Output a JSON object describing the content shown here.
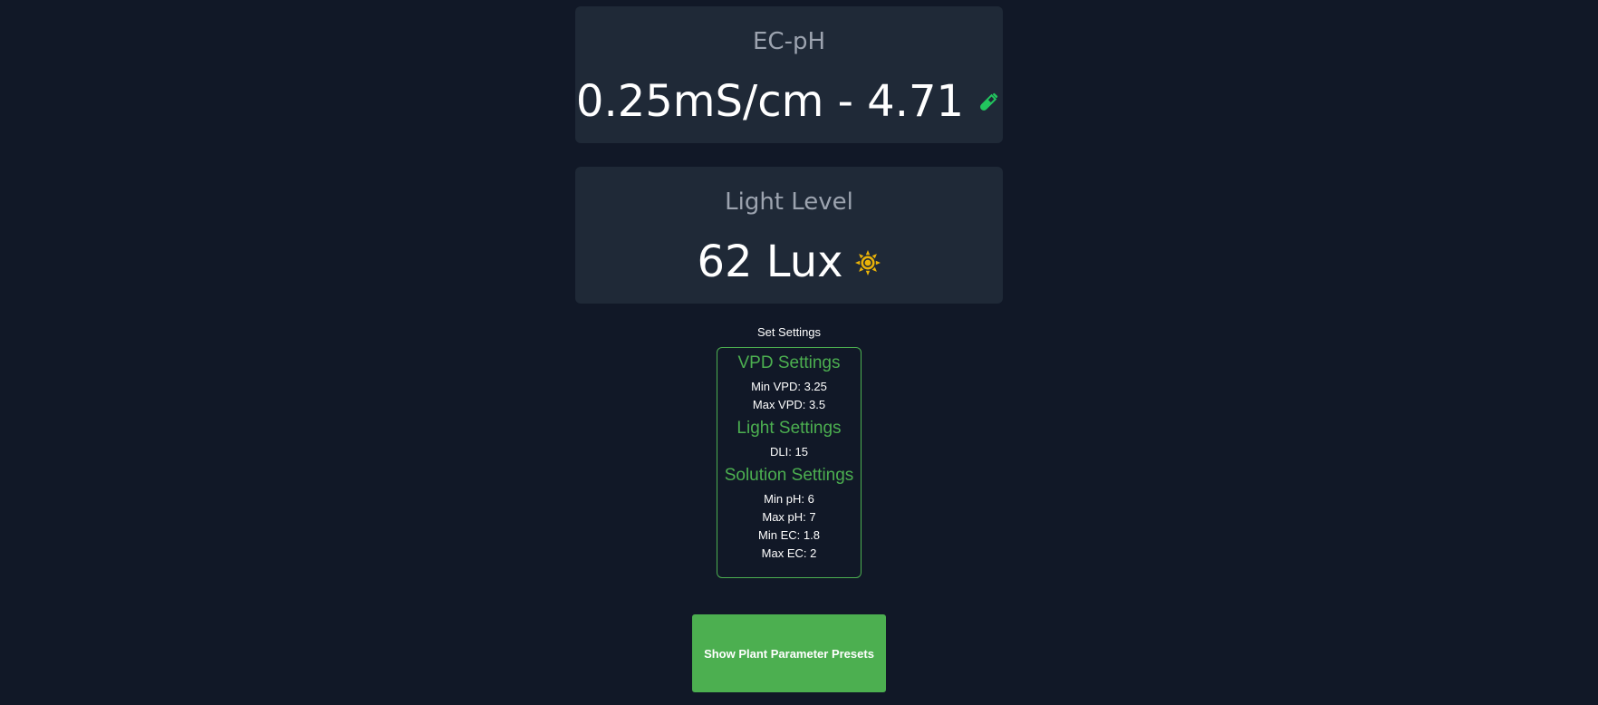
{
  "ecph_card": {
    "title": "EC-pH",
    "value": "0.25mS/cm - 4.71",
    "icon": "test-tube-icon",
    "icon_color": "#22c55e"
  },
  "light_card": {
    "title": "Light Level",
    "value": "62 Lux",
    "icon": "sun-icon",
    "icon_color": "#eab308"
  },
  "settings": {
    "label": "Set Settings",
    "accent_color": "#4caf50",
    "vpd": {
      "heading": "VPD Settings",
      "lines": [
        "Min VPD: 3.25",
        "Max VPD: 3.5"
      ]
    },
    "light": {
      "heading": "Light Settings",
      "lines": [
        "DLI: 15"
      ]
    },
    "solution": {
      "heading": "Solution Settings",
      "lines": [
        "Min pH: 6",
        "Max pH: 7",
        "Min EC: 1.8",
        "Max EC: 2"
      ]
    }
  },
  "preset_button": {
    "label": "Show Plant Parameter Presets"
  }
}
